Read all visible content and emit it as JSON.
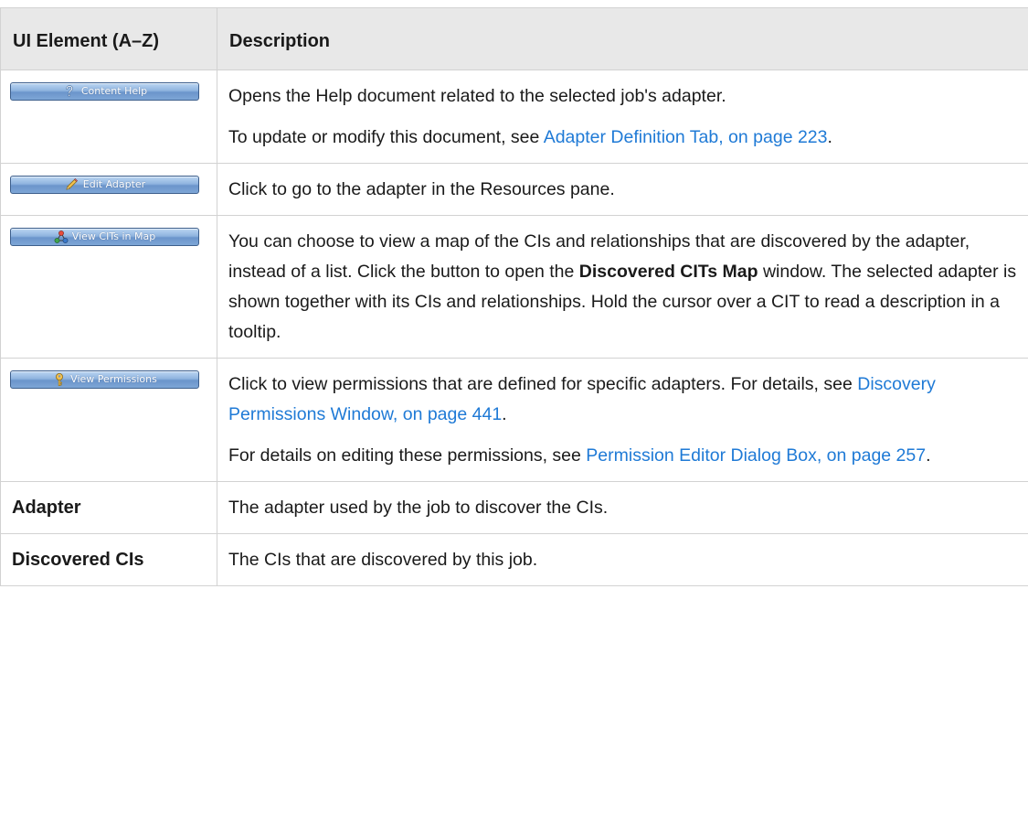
{
  "table": {
    "headers": {
      "element": "UI Element (A–Z)",
      "description": "Description"
    },
    "rows": [
      {
        "button": {
          "label": "Content Help",
          "icon": "help-question-icon"
        },
        "description": [
          {
            "text": "Opens the Help document related to the selected job's adapter."
          },
          {
            "before": "To update or modify this document, see ",
            "link": "Adapter Definition Tab, on page 223",
            "after": "."
          }
        ]
      },
      {
        "button": {
          "label": "Edit Adapter",
          "icon": "pencil-icon"
        },
        "description": [
          {
            "text": "Click to go to the adapter in the Resources pane."
          }
        ]
      },
      {
        "button": {
          "label": "View CITs in Map",
          "icon": "topology-map-icon"
        },
        "description": [
          {
            "before": "You can choose to view a map of the CIs and relationships that are discovered by the adapter, instead of a list. Click the button to open the ",
            "bold": "Discovered CITs Map",
            "after": " window. The selected adapter is shown together with its CIs and relationships. Hold the cursor over a CIT to read a description in a tooltip."
          }
        ]
      },
      {
        "button": {
          "label": "View Permissions",
          "icon": "key-icon"
        },
        "description": [
          {
            "before": "Click to view permissions that are defined for specific adapters. For details, see ",
            "link": "Discovery Permissions Window, on page 441",
            "after": "."
          },
          {
            "before": "For details on editing these permissions, see ",
            "link": "Permission Editor Dialog Box, on page 257",
            "after": "."
          }
        ]
      },
      {
        "element": "Adapter",
        "description": [
          {
            "text": "The adapter used by the job to discover the CIs."
          }
        ]
      },
      {
        "element": "Discovered CIs",
        "description": [
          {
            "text": "The CIs that are discovered by this job."
          }
        ]
      }
    ]
  }
}
